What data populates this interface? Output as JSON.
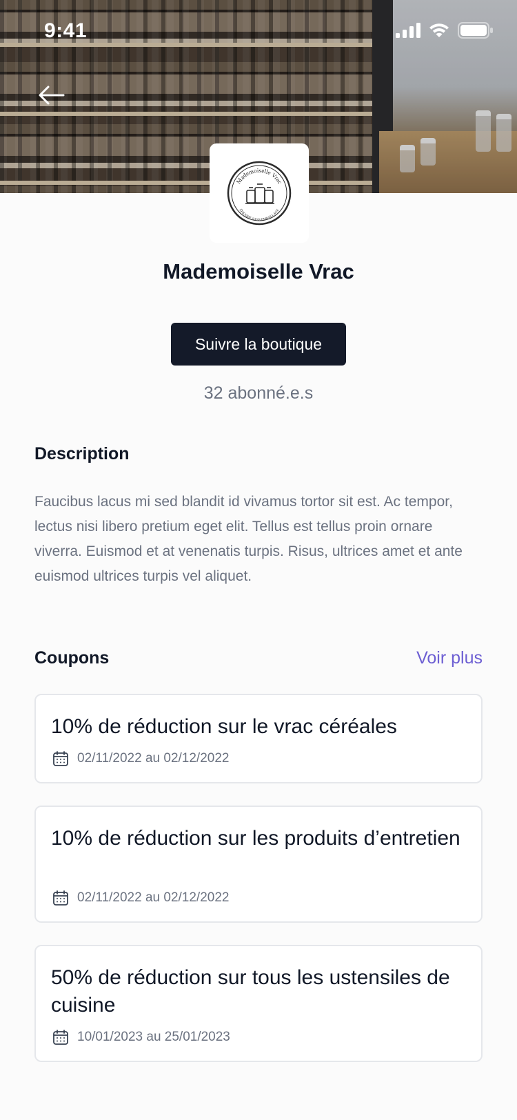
{
  "status_bar": {
    "time": "9:41"
  },
  "shop": {
    "name": "Mademoiselle Vrac",
    "logo_text_top": "Mademoiselle Vrac",
    "logo_text_bottom": "ÉPICERIE SANS EMBALLAGE",
    "follow_label": "Suivre la boutique",
    "followers": "32 abonné.e.s"
  },
  "description": {
    "title": "Description",
    "text": "Faucibus lacus mi sed blandit id vivamus tortor sit est. Ac tempor, lectus nisi libero pretium eget elit. Tellus est tellus proin ornare viverra. Euismod et at venenatis turpis. Risus, ultrices amet et ante euismod ultrices turpis vel aliquet."
  },
  "coupons": {
    "title": "Coupons",
    "see_more": "Voir plus",
    "items": [
      {
        "title": "10% de réduction sur le vrac céréales",
        "dates": "02/11/2022 au 02/12/2022"
      },
      {
        "title": "10% de réduction sur les produits d’entretien",
        "dates": "02/11/2022 au 02/12/2022"
      },
      {
        "title": "50% de réduction sur tous les ustensiles de cuisine",
        "dates": "10/01/2023 au 25/01/2023"
      }
    ]
  },
  "icons": {
    "back": "arrow-left-icon",
    "calendar": "calendar-icon",
    "signal": "cellular-signal-icon",
    "wifi": "wifi-icon",
    "battery": "battery-icon"
  },
  "colors": {
    "primary_button": "#141a29",
    "link": "#6d5fd3",
    "text_muted": "#6b7280",
    "card_border": "#e5e7eb"
  }
}
